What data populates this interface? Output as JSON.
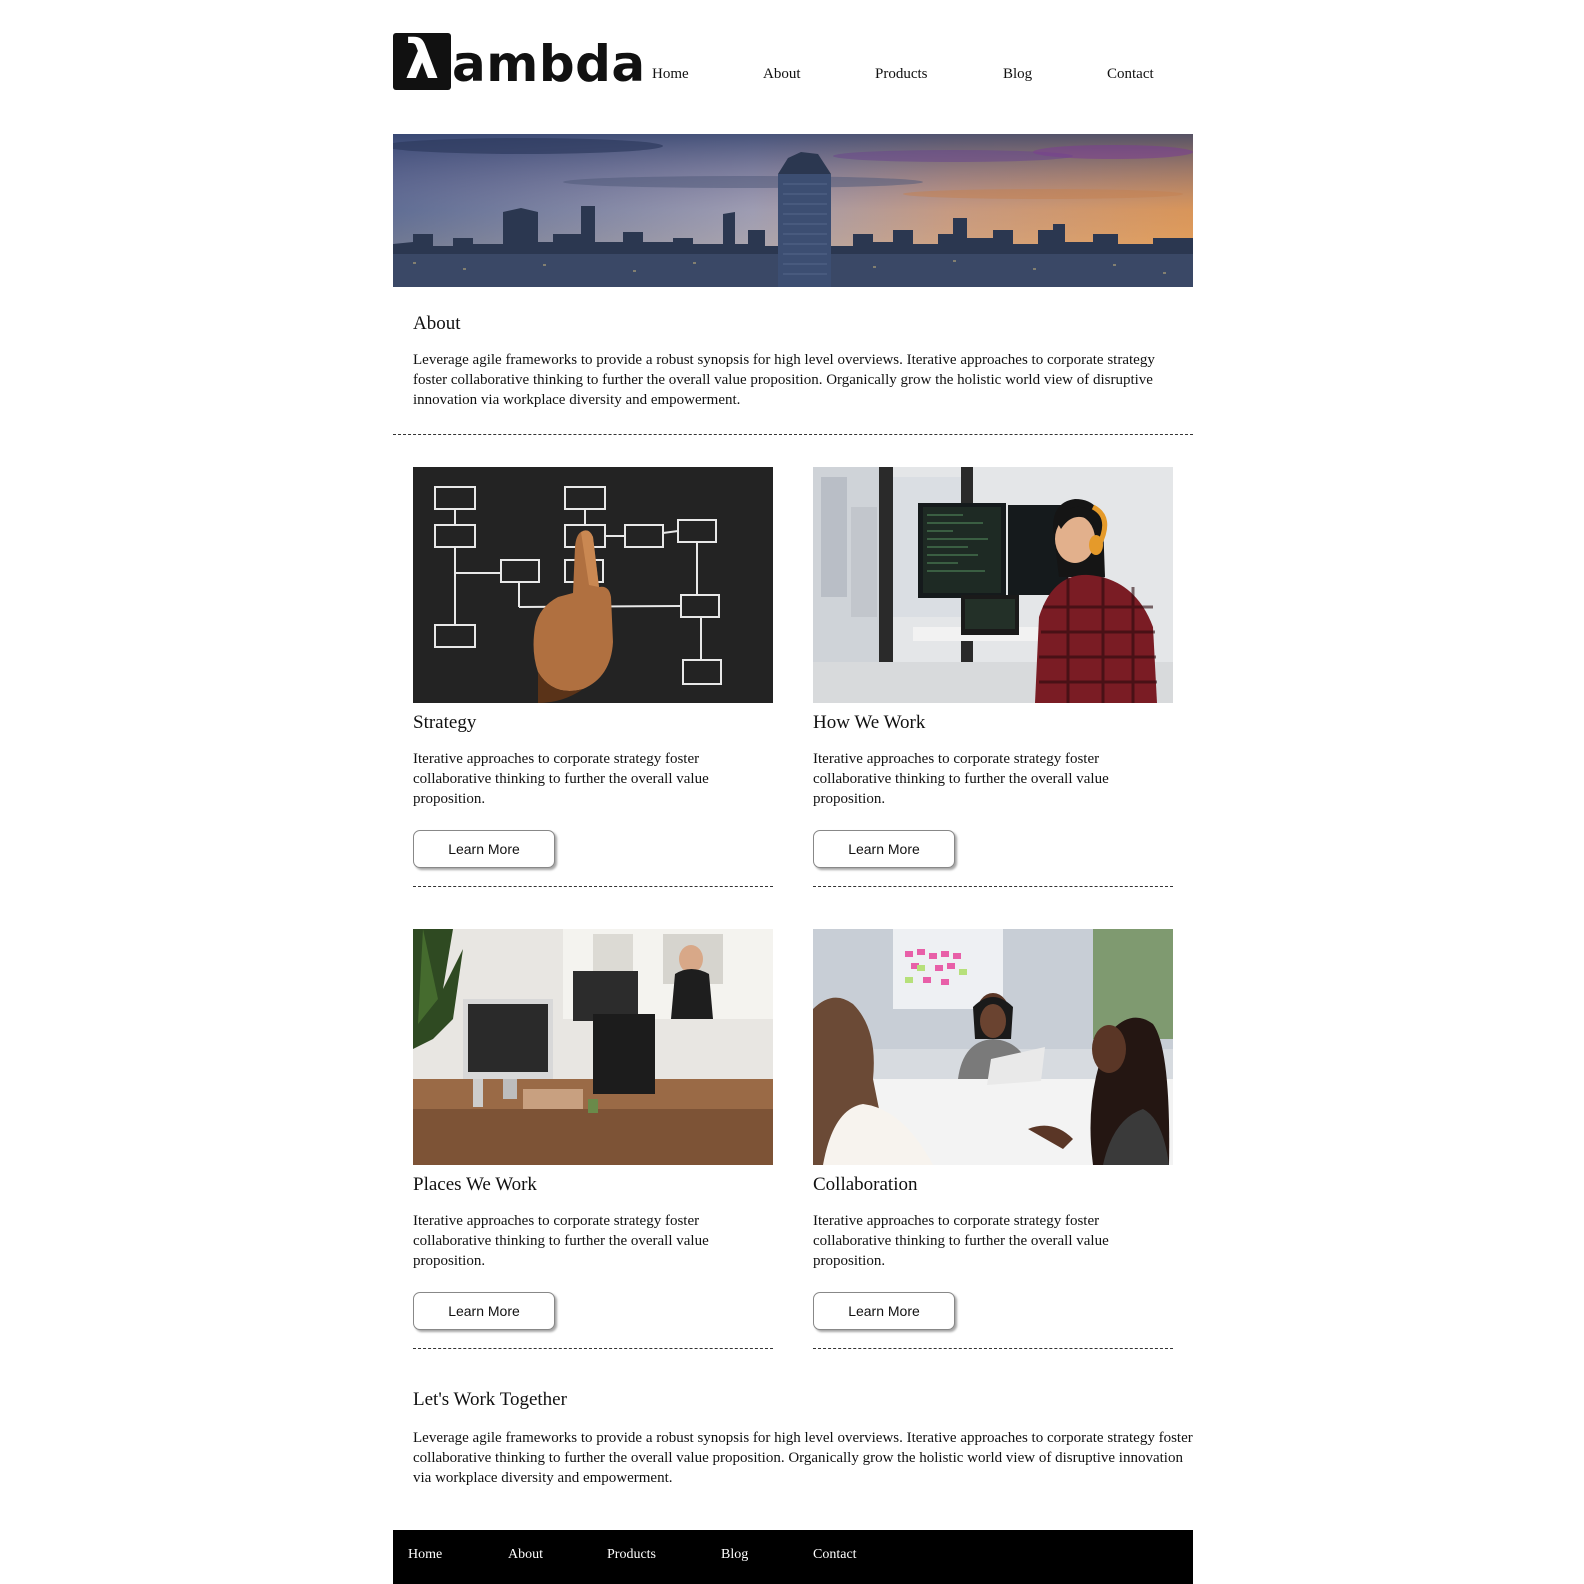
{
  "logo": {
    "mark": "λ",
    "text": "ambda"
  },
  "nav": [
    "Home",
    "About",
    "Products",
    "Blog",
    "Contact"
  ],
  "about": {
    "title": "About",
    "text": "Leverage agile frameworks to provide a robust synopsis for high level overviews. Iterative approaches to corporate strategy foster collaborative thinking to further the overall value proposition. Organically grow the holistic world view of disruptive innovation via workplace diversity and empowerment."
  },
  "cards": [
    {
      "title": "Strategy",
      "text": "Iterative approaches to corporate strategy foster collaborative thinking to further the overall value proposition.",
      "button": "Learn More"
    },
    {
      "title": "How We Work",
      "text": "Iterative approaches to corporate strategy foster collaborative thinking to further the overall value proposition.",
      "button": "Learn More"
    },
    {
      "title": "Places We Work",
      "text": "Iterative approaches to corporate strategy foster collaborative thinking to further the overall value proposition.",
      "button": "Learn More"
    },
    {
      "title": "Collaboration",
      "text": "Iterative approaches to corporate strategy foster collaborative thinking to further the overall value proposition.",
      "button": "Learn More"
    }
  ],
  "together": {
    "title": "Let's Work Together",
    "text": "Leverage agile frameworks to provide a robust synopsis for high level overviews. Iterative approaches to corporate strategy foster collaborative thinking to further the overall value proposition. Organically grow the holistic world view of disruptive innovation via workplace diversity and empowerment."
  },
  "footer_nav": [
    "Home",
    "About",
    "Products",
    "Blog",
    "Contact"
  ]
}
